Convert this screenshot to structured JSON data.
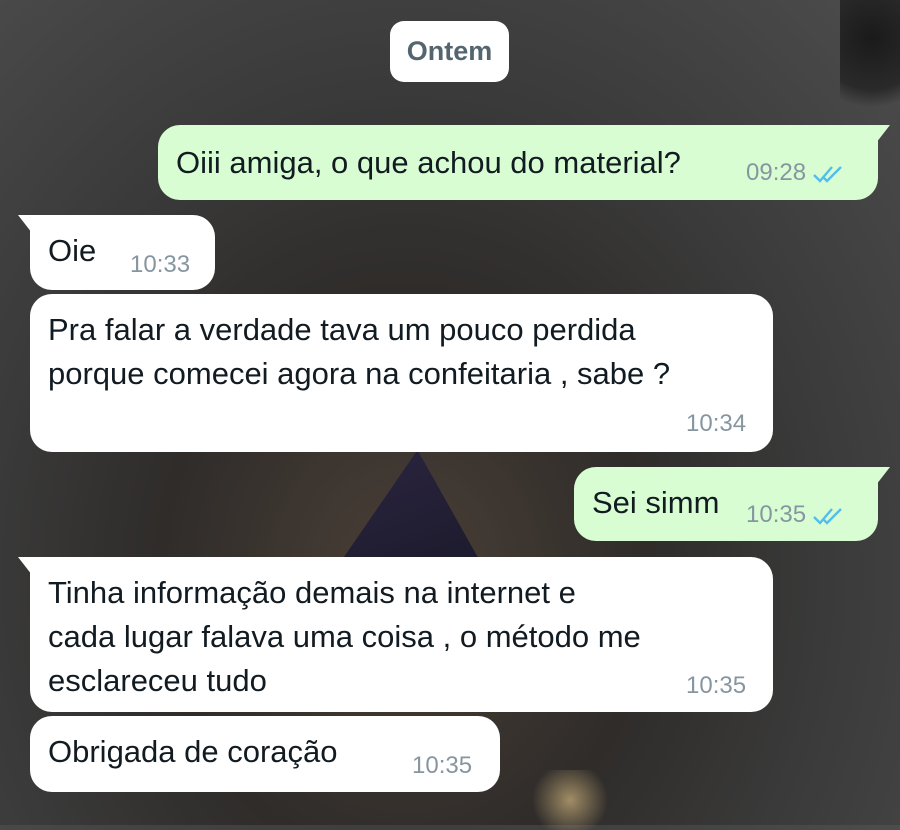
{
  "date_separator": "Ontem",
  "messages": [
    {
      "text": "Oiii amiga, o que achou do material?",
      "time": "09:28",
      "direction": "outgoing",
      "status": "read"
    },
    {
      "text": "Oie",
      "time": "10:33",
      "direction": "incoming"
    },
    {
      "text": "Pra falar a verdade tava um pouco perdida\nporque comecei agora na confeitaria , sabe ?",
      "time": "10:34",
      "direction": "incoming"
    },
    {
      "text": "Sei simm",
      "time": "10:35",
      "direction": "outgoing",
      "status": "read"
    },
    {
      "text": "Tinha informação demais na internet e\ncada lugar falava uma coisa , o método me\nesclareceu tudo",
      "time": "10:35",
      "direction": "incoming"
    },
    {
      "text": "Obrigada de coração",
      "time": "10:35",
      "direction": "incoming"
    }
  ],
  "colors": {
    "incoming_bubble": "#ffffff",
    "outgoing_bubble": "#d9fdd3",
    "read_ticks": "#53bdeb",
    "timestamp": "#8696a0"
  }
}
